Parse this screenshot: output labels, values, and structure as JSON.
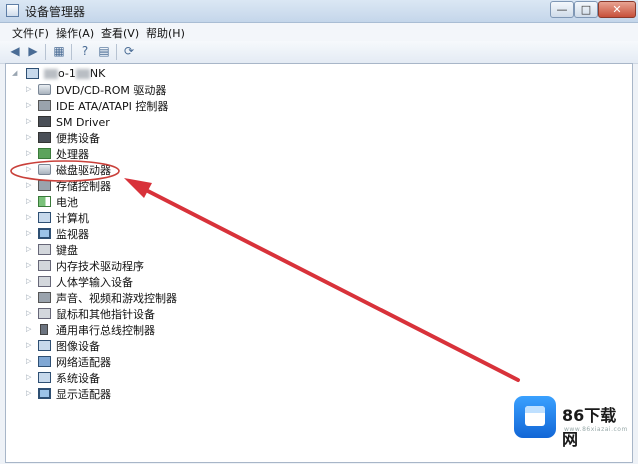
{
  "window": {
    "title": "设备管理器",
    "controls": {
      "minimize": "—",
      "maximize": "□",
      "close": "✕"
    }
  },
  "menu": [
    "文件(F)",
    "操作(A)",
    "查看(V)",
    "帮助(H)"
  ],
  "toolbar": [
    "back-arrow-icon",
    "forward-arrow-icon",
    "show-hide-console-icon",
    "help-icon",
    "properties-icon",
    "scan-hardware-icon"
  ],
  "tree": {
    "computer": {
      "prefix": "",
      "suffix": "o-1",
      "suffix2": "NK"
    },
    "devices": [
      {
        "label": "DVD/CD-ROM 驱动器",
        "icon": "disk"
      },
      {
        "label": "IDE ATA/ATAPI 控制器",
        "icon": "port"
      },
      {
        "label": "SM Driver",
        "icon": "chip"
      },
      {
        "label": "便携设备",
        "icon": "chip"
      },
      {
        "label": "处理器",
        "icon": "board"
      },
      {
        "label": "磁盘驱动器",
        "icon": "disk"
      },
      {
        "label": "存储控制器",
        "icon": "port"
      },
      {
        "label": "电池",
        "icon": "battery"
      },
      {
        "label": "计算机",
        "icon": "pc"
      },
      {
        "label": "监视器",
        "icon": "mon"
      },
      {
        "label": "键盘",
        "icon": "gray"
      },
      {
        "label": "内存技术驱动程序",
        "icon": "gray"
      },
      {
        "label": "人体学输入设备",
        "icon": "gray"
      },
      {
        "label": "声音、视频和游戏控制器",
        "icon": "port"
      },
      {
        "label": "鼠标和其他指针设备",
        "icon": "gray"
      },
      {
        "label": "通用串行总线控制器",
        "icon": "usb"
      },
      {
        "label": "图像设备",
        "icon": "pc"
      },
      {
        "label": "网络适配器",
        "icon": "net"
      },
      {
        "label": "系统设备",
        "icon": "pc"
      },
      {
        "label": "显示适配器",
        "icon": "mon"
      }
    ]
  },
  "annotation": {
    "highlight_color": "#c9403a",
    "arrow_color": "#d8323a"
  },
  "watermark": {
    "name": "86下载网",
    "url": "www.86xiazai.com"
  }
}
